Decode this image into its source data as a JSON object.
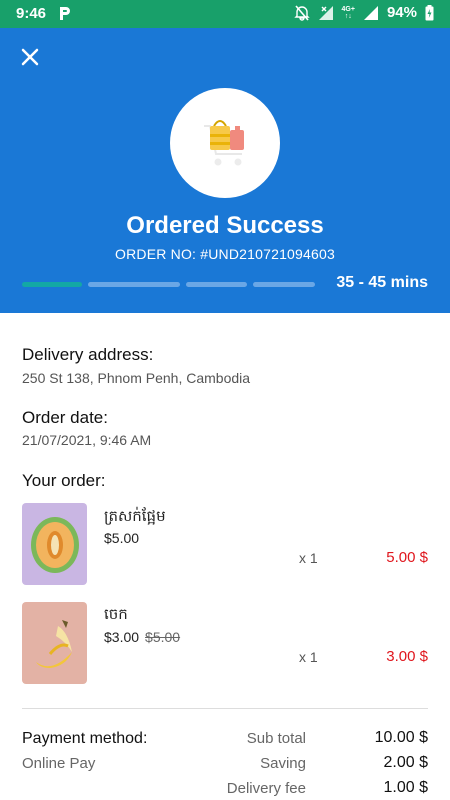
{
  "status_bar": {
    "time": "9:46",
    "battery": "94%",
    "network_top": "4G+",
    "network_bottom": "↑↓",
    "color": "#18a06a"
  },
  "header": {
    "title": "Ordered Success",
    "order_no": "ORDER NO: #UND210721094603",
    "eta": "35 - 45 mins",
    "progress_steps": 4,
    "progress_active": 1,
    "color": "#1a78d6",
    "icons": [
      "close-icon",
      "shopping-basket-icon"
    ]
  },
  "delivery": {
    "label": "Delivery address:",
    "value": "250 St 138, Phnom Penh, Cambodia"
  },
  "order_date": {
    "label": "Order date:",
    "value": "21/07/2021, 9:46 AM"
  },
  "your_order_label": "Your order:",
  "items": [
    {
      "name": "ត្រសក់ផ្អែម",
      "price": "$5.00",
      "old_price": "",
      "qty": "x 1",
      "total": "5.00 $",
      "image": "melon"
    },
    {
      "name": "ចេក",
      "price": "$3.00",
      "old_price": "$5.00",
      "qty": "x 1",
      "total": "3.00 $",
      "image": "banana"
    }
  ],
  "payment": {
    "label": "Payment method:",
    "value": "Online Pay"
  },
  "summary": [
    {
      "label": "Sub total",
      "value": "10.00 $"
    },
    {
      "label": "Saving",
      "value": "2.00 $"
    },
    {
      "label": "Delivery fee",
      "value": "1.00 $"
    }
  ],
  "accent_red": "#e0161d"
}
